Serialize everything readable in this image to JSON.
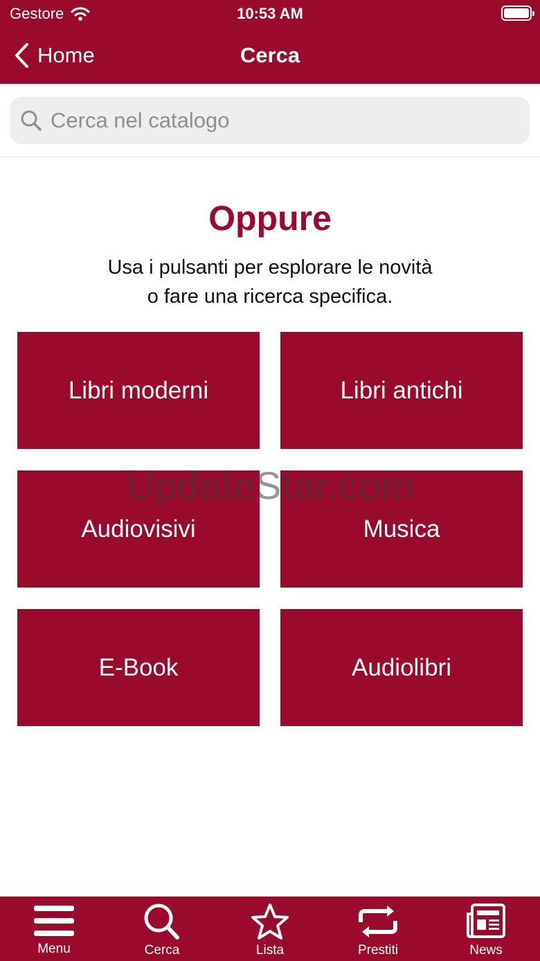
{
  "status_bar": {
    "carrier": "Gestore",
    "time": "10:53 AM"
  },
  "nav": {
    "back_label": "Home",
    "title": "Cerca"
  },
  "search": {
    "placeholder": "Cerca nel catalogo",
    "value": ""
  },
  "intro": {
    "heading": "Oppure",
    "line1": "Usa i pulsanti per esplorare le novità",
    "line2": "o fare una ricerca specifica."
  },
  "categories": [
    {
      "label": "Libri moderni"
    },
    {
      "label": "Libri antichi"
    },
    {
      "label": "Audiovisivi"
    },
    {
      "label": "Musica"
    },
    {
      "label": "E-Book"
    },
    {
      "label": "Audiolibri"
    }
  ],
  "watermark": "UpdateStar.com",
  "tabs": [
    {
      "label": "Menu",
      "icon": "menu-icon"
    },
    {
      "label": "Cerca",
      "icon": "search-icon"
    },
    {
      "label": "Lista",
      "icon": "star-icon"
    },
    {
      "label": "Prestiti",
      "icon": "repeat-icon"
    },
    {
      "label": "News",
      "icon": "newspaper-icon"
    }
  ],
  "colors": {
    "brand": "#990a2c",
    "background": "#ffffff",
    "search_field": "#eeeeef"
  }
}
